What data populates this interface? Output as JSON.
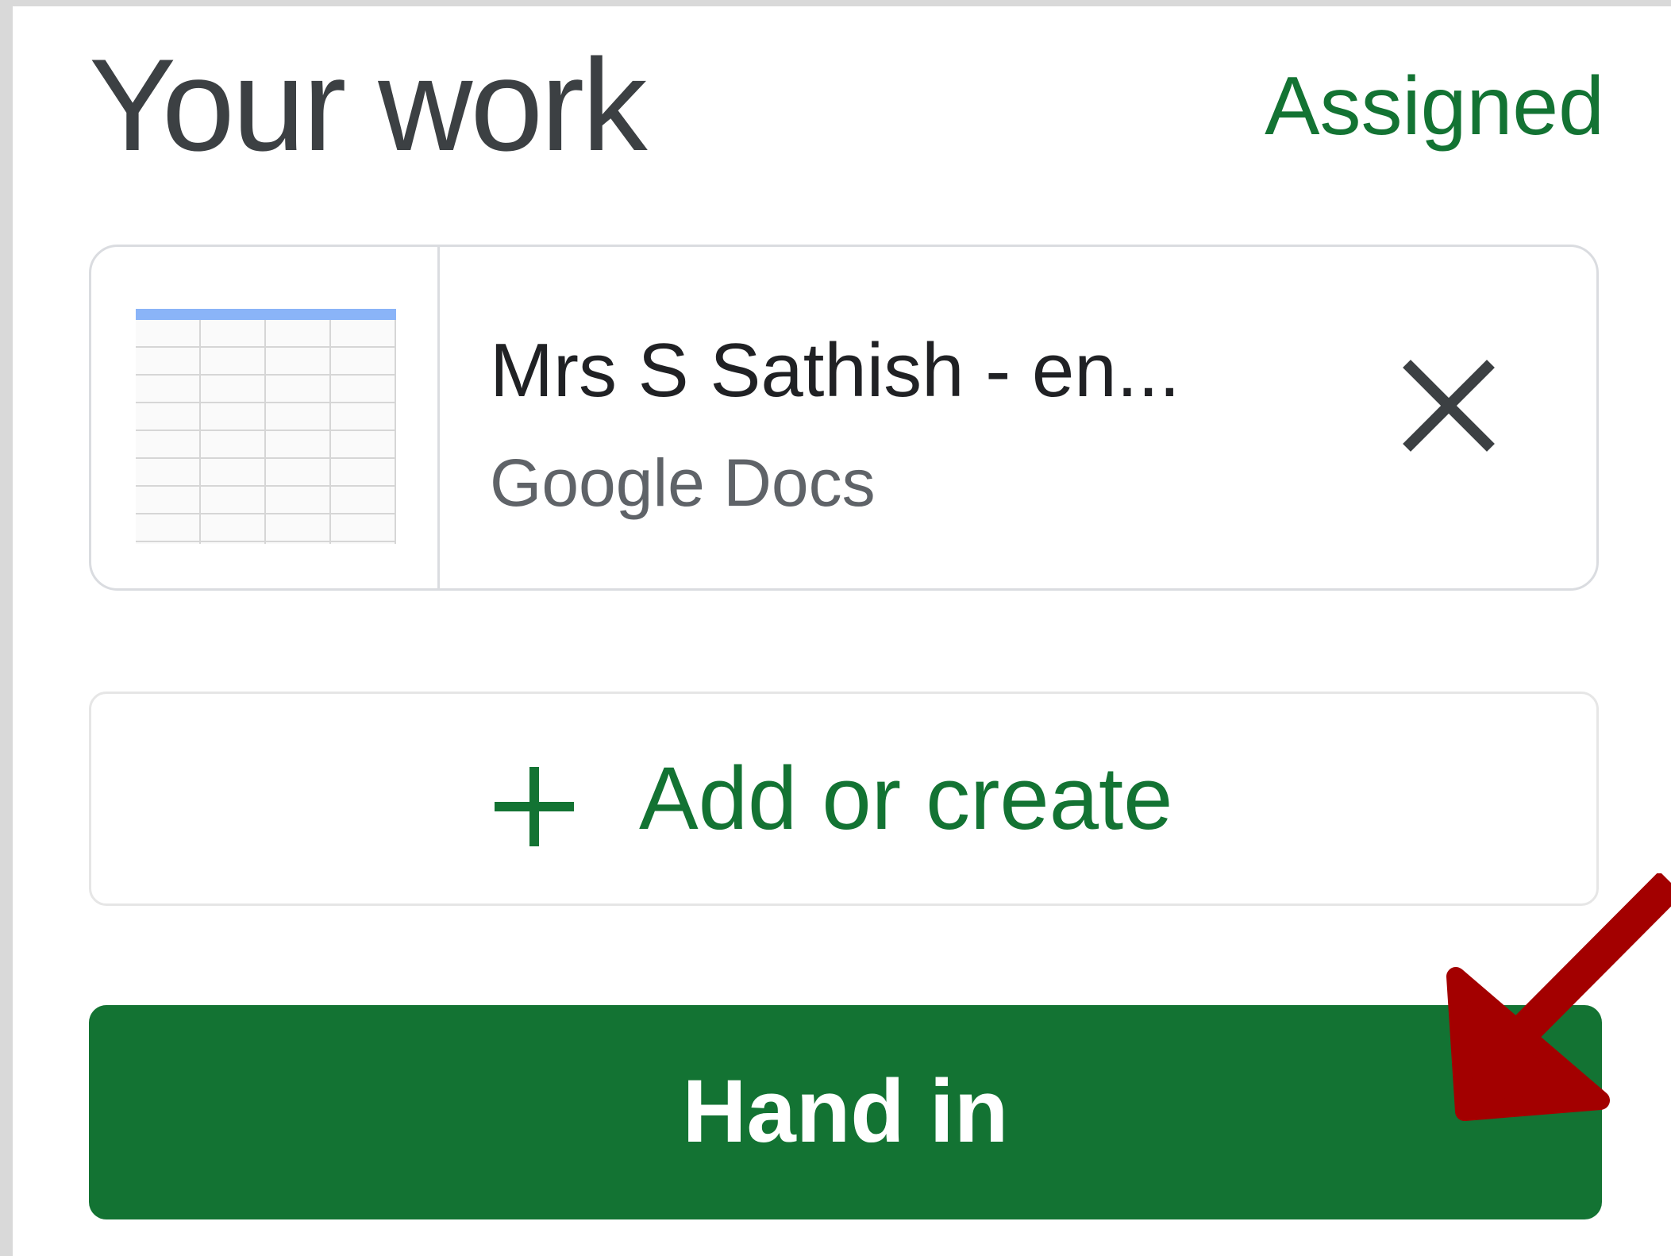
{
  "work": {
    "title": "Your work",
    "status": "Assigned",
    "attachment": {
      "name": "Mrs S Sathish - en...",
      "type": "Google Docs",
      "thumbnail_icon": "spreadsheet-thumbnail",
      "remove_icon": "close-icon"
    },
    "add_button": {
      "icon": "plus-icon",
      "label": "Add or create"
    },
    "hand_in_button": {
      "label": "Hand in"
    }
  },
  "colors": {
    "accent_green": "#137333",
    "annotation_arrow": "#a30000"
  }
}
